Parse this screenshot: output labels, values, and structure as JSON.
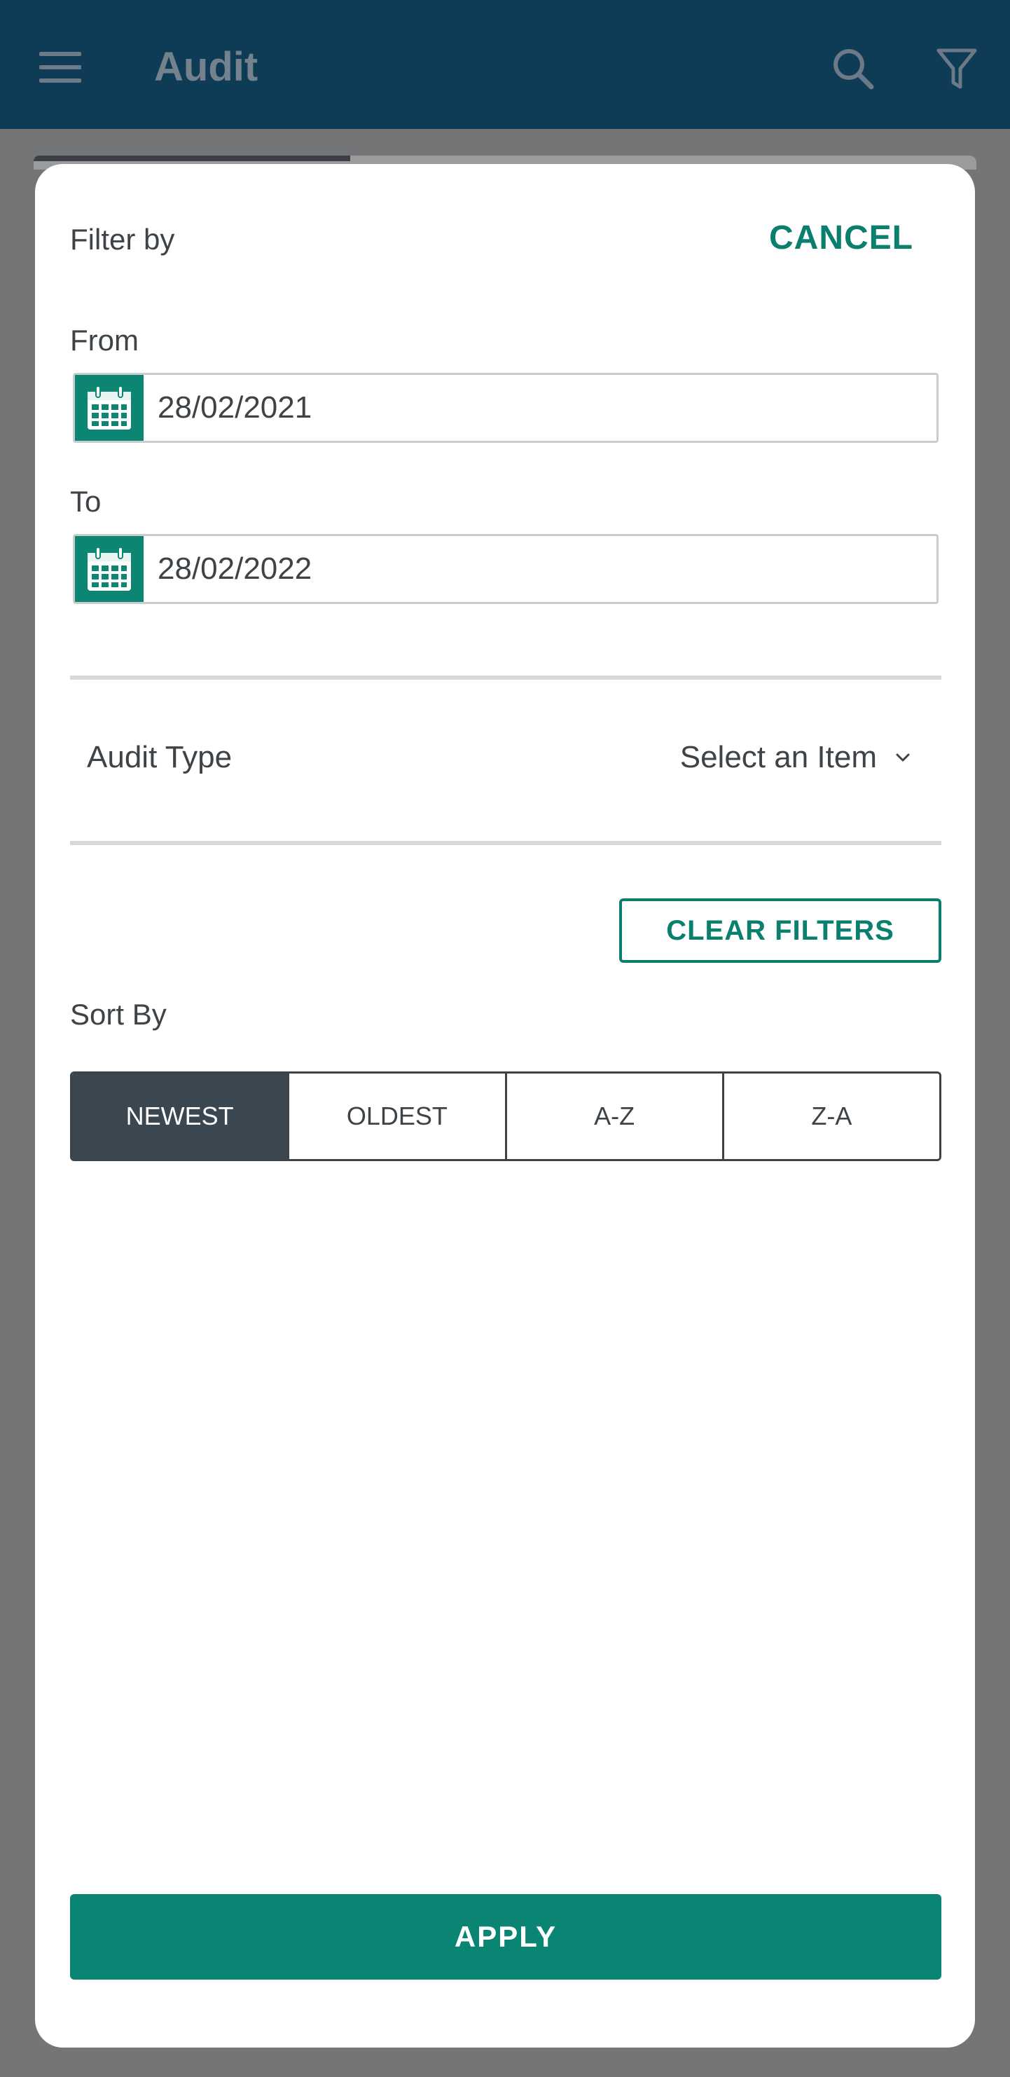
{
  "app_bar": {
    "title": "Audit",
    "menu_icon": "hamburger-menu-icon",
    "search_icon": "search-icon",
    "filter_icon": "filter-funnel-icon"
  },
  "filter_modal": {
    "heading": "Filter by",
    "cancel_label": "CANCEL",
    "from": {
      "label": "From",
      "value": "28/02/2021",
      "icon": "calendar-icon"
    },
    "to": {
      "label": "To",
      "value": "28/02/2022",
      "icon": "calendar-icon"
    },
    "audit_type": {
      "label": "Audit Type",
      "selected": "Select an Item",
      "icon": "chevron-down-icon"
    },
    "clear_filters_label": "CLEAR FILTERS",
    "sort": {
      "label": "Sort By",
      "options": [
        "NEWEST",
        "OLDEST",
        "A-Z",
        "Z-A"
      ],
      "selected": "NEWEST"
    },
    "apply_label": "APPLY"
  },
  "colors": {
    "accent": "#0a8473",
    "app_bar": "#0e3b56",
    "active_sort": "#3a4650",
    "overlay": "#747577"
  }
}
